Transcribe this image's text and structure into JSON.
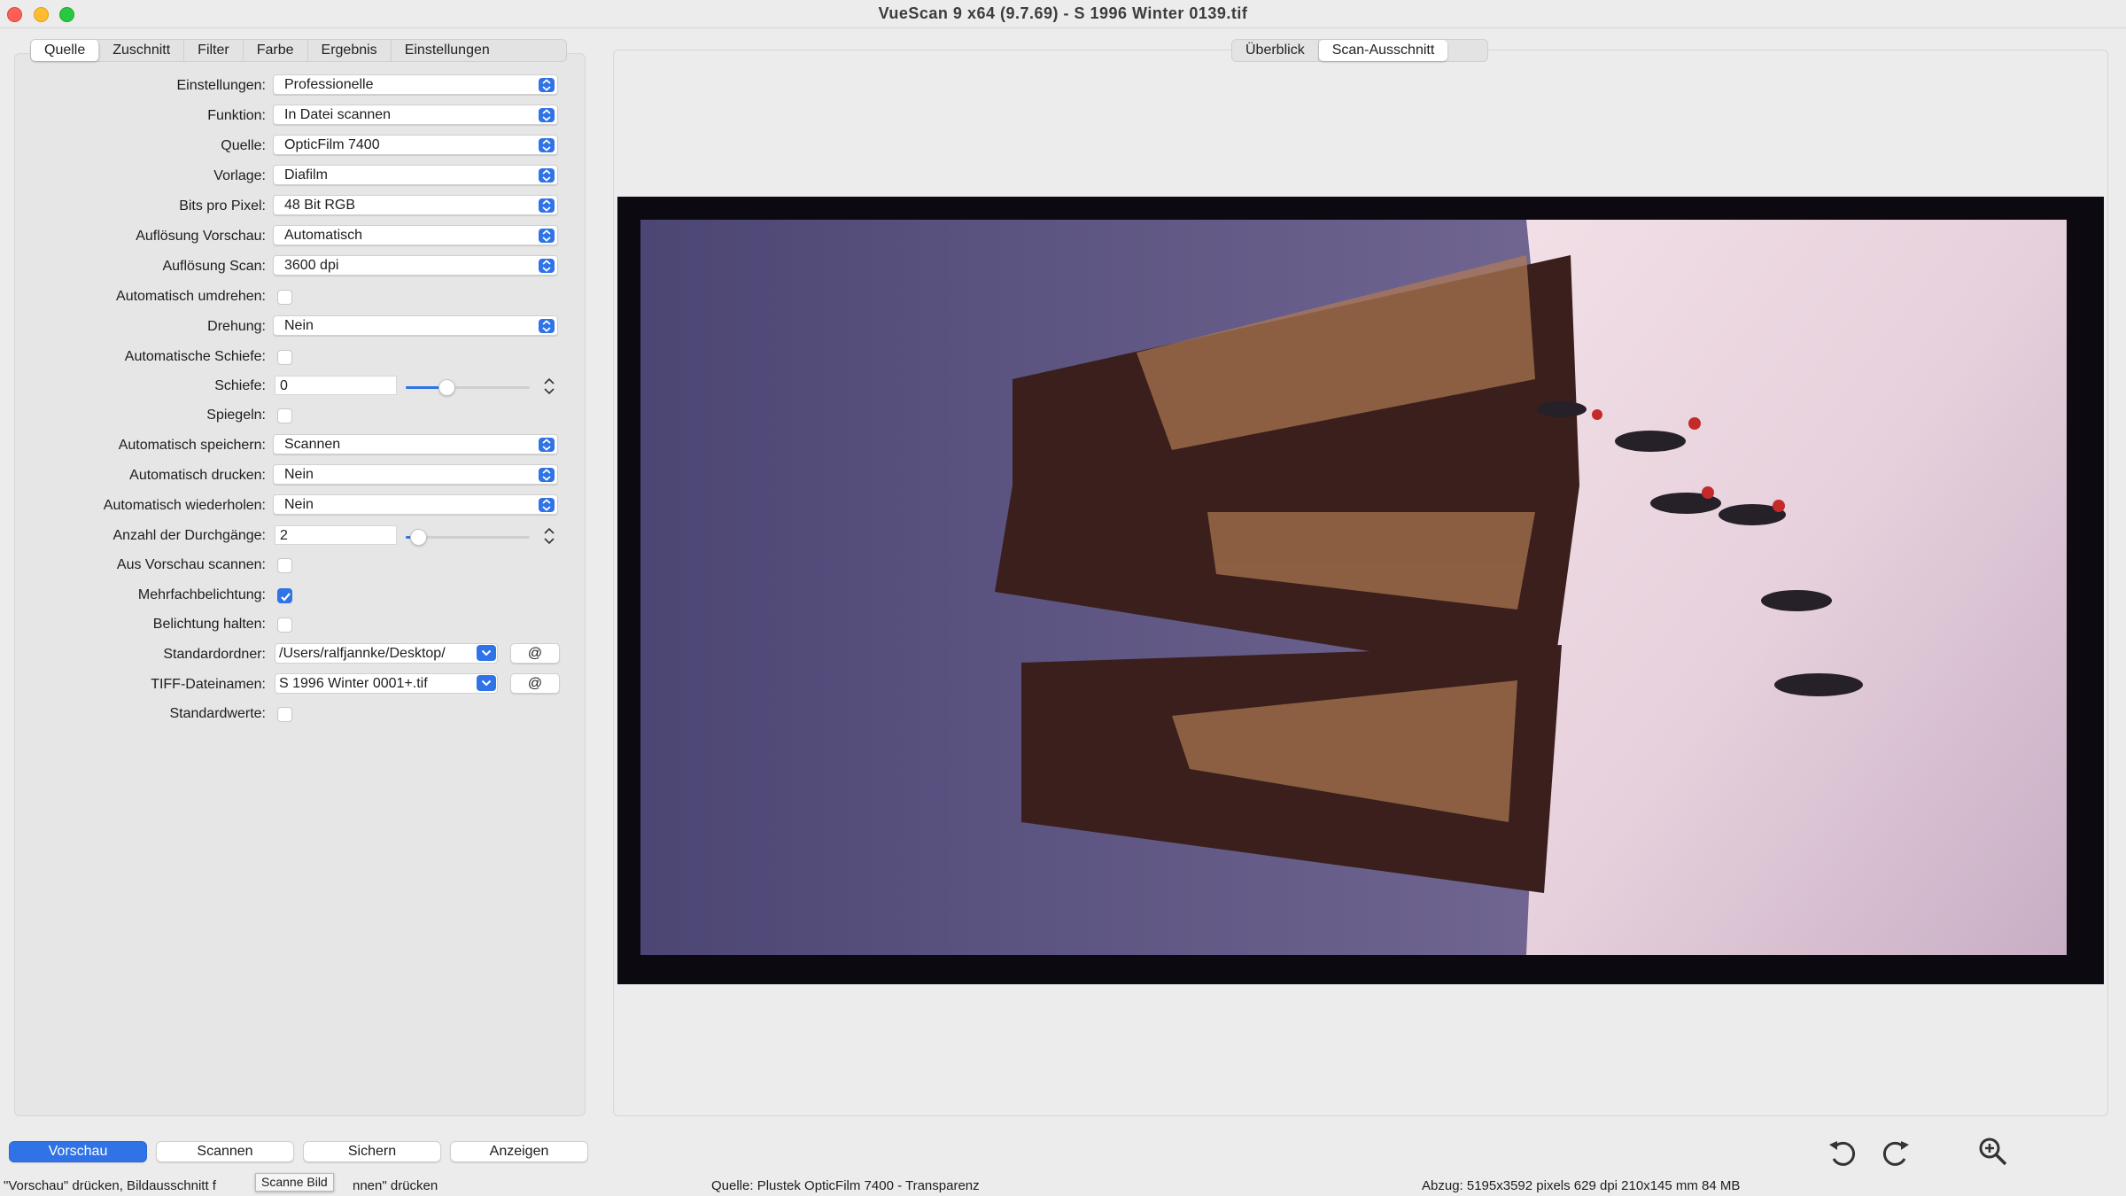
{
  "window": {
    "title": "VueScan 9 x64 (9.7.69) - S 1996 Winter 0139.tif"
  },
  "left_tabs": [
    "Quelle",
    "Zuschnitt",
    "Filter",
    "Farbe",
    "Ergebnis",
    "Einstellungen"
  ],
  "right_tabs": [
    "Überblick",
    "Scan-Ausschnitt"
  ],
  "settings": {
    "einstellungen": {
      "label": "Einstellungen:",
      "value": "Professionelle"
    },
    "funktion": {
      "label": "Funktion:",
      "value": "In Datei scannen"
    },
    "quelle": {
      "label": "Quelle:",
      "value": "OpticFilm 7400"
    },
    "vorlage": {
      "label": "Vorlage:",
      "value": "Diafilm"
    },
    "bits": {
      "label": "Bits pro Pixel:",
      "value": "48 Bit RGB"
    },
    "aufl_vorschau": {
      "label": "Auflösung Vorschau:",
      "value": "Automatisch"
    },
    "aufl_scan": {
      "label": "Auflösung Scan:",
      "value": "3600 dpi"
    },
    "auto_umdrehen": {
      "label": "Automatisch umdrehen:",
      "checked": false
    },
    "drehung": {
      "label": "Drehung:",
      "value": "Nein"
    },
    "auto_schiefe": {
      "label": "Automatische Schiefe:",
      "checked": false
    },
    "schiefe": {
      "label": "Schiefe:",
      "value": "0",
      "slider_fraction": 0.33
    },
    "spiegeln": {
      "label": "Spiegeln:",
      "checked": false
    },
    "auto_speichern": {
      "label": "Automatisch speichern:",
      "value": "Scannen"
    },
    "auto_drucken": {
      "label": "Automatisch drucken:",
      "value": "Nein"
    },
    "auto_wiederholen": {
      "label": "Automatisch wiederholen:",
      "value": "Nein"
    },
    "durchgaenge": {
      "label": "Anzahl der Durchgänge:",
      "value": "2",
      "slider_fraction": 0.1
    },
    "aus_vorschau": {
      "label": "Aus Vorschau scannen:",
      "checked": false
    },
    "mehrfach": {
      "label": "Mehrfachbelichtung:",
      "checked": true
    },
    "belichtung": {
      "label": "Belichtung halten:",
      "checked": false
    },
    "standardordner": {
      "label": "Standardordner:",
      "value": "/Users/ralfjannke/Desktop/",
      "button": "@"
    },
    "tiff_name": {
      "label": "TIFF-Dateinamen:",
      "value": "S 1996 Winter 0001+.tif",
      "button": "@"
    },
    "standardwerte": {
      "label": "Standardwerte:",
      "checked": false
    }
  },
  "buttons": {
    "vorschau": "Vorschau",
    "scannen": "Scannen",
    "sichern": "Sichern",
    "anzeigen": "Anzeigen"
  },
  "tooltip": "Scanne Bild",
  "status": {
    "left": "\"Vorschau\" drücken, Bildausschnitt f",
    "left_tail": "nnen\" drücken",
    "middle": "Quelle: Plustek OpticFilm 7400 - Transparenz",
    "right": "Abzug: 5195x3592 pixels 629 dpi 210x145 mm 84 MB"
  },
  "icons": {
    "rotate_left": "rotate-left-icon",
    "rotate_right": "rotate-right-icon",
    "zoom_in": "zoom-in-icon"
  },
  "colors": {
    "accent": "#2f73e6"
  }
}
